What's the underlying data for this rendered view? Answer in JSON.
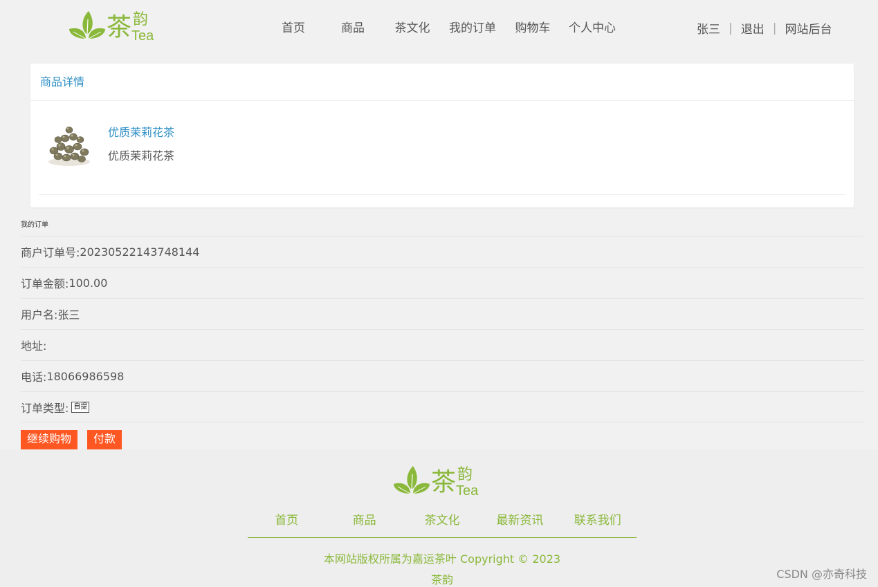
{
  "header": {
    "logo": {
      "cn": "茶",
      "cn2": "韵",
      "tea": "Tea"
    },
    "nav": [
      {
        "label": "首页"
      },
      {
        "label": "商品"
      },
      {
        "label": "茶文化"
      },
      {
        "label": "我的订单"
      },
      {
        "label": "购物车"
      },
      {
        "label": "个人中心"
      }
    ],
    "user": {
      "name": "张三",
      "logout": "退出",
      "admin": "网站后台",
      "separator": "|"
    }
  },
  "product_panel": {
    "title": "商品详情",
    "name": "优质茉莉花茶",
    "description": "优质茉莉花茶"
  },
  "order": {
    "section_title": "我的订单",
    "fields": [
      {
        "label": "商户订单号:",
        "value": "20230522143748144"
      },
      {
        "label": "订单金额:",
        "value": "100.00"
      },
      {
        "label": "用户名:",
        "value": "张三"
      },
      {
        "label": "地址:",
        "value": ""
      },
      {
        "label": "电话:",
        "value": "18066986598"
      }
    ],
    "type_label": "订单类型:",
    "type_value": "自提",
    "buttons": {
      "continue": "继续购物",
      "pay": "付款"
    }
  },
  "footer": {
    "logo": {
      "cn": "茶",
      "cn2": "韵",
      "tea": "Tea"
    },
    "nav": [
      {
        "label": "首页"
      },
      {
        "label": "商品"
      },
      {
        "label": "茶文化"
      },
      {
        "label": "最新资讯"
      },
      {
        "label": "联系我们"
      }
    ],
    "copyright": "本网站版权所属为嘉运茶叶 Copyright © 2023",
    "brand": "茶韵"
  },
  "watermark": "CSDN @亦奇科技",
  "colors": {
    "accent_green": "#8ab83a",
    "link_blue": "#2d8fc4",
    "button_orange": "#ff5722"
  }
}
